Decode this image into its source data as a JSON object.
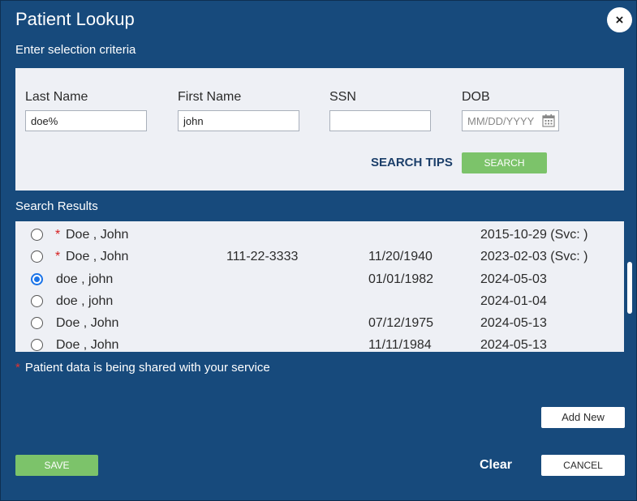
{
  "dialog": {
    "title": "Patient Lookup",
    "subtitle": "Enter selection criteria",
    "close_icon": "×"
  },
  "criteria": {
    "last_name_label": "Last Name",
    "last_name_value": "doe%",
    "first_name_label": "First Name",
    "first_name_value": "john",
    "ssn_label": "SSN",
    "ssn_value": "",
    "dob_label": "DOB",
    "dob_value": "",
    "dob_placeholder": "MM/DD/YYYY",
    "calendar_icon": "calendar-icon",
    "search_tips_label": "SEARCH TIPS",
    "search_label": "SEARCH"
  },
  "results": {
    "label": "Search Results",
    "rows": [
      {
        "shared": "*",
        "name": "Doe , John",
        "ssn": "",
        "dob": "",
        "date": "2015-10-29 (Svc: )",
        "selected": false
      },
      {
        "shared": "*",
        "name": "Doe , John",
        "ssn": "111-22-3333",
        "dob": "11/20/1940",
        "date": "2023-02-03 (Svc: )",
        "selected": false
      },
      {
        "shared": "",
        "name": "doe , john",
        "ssn": "",
        "dob": "01/01/1982",
        "date": "2024-05-03",
        "selected": true
      },
      {
        "shared": "",
        "name": "doe , john",
        "ssn": "",
        "dob": "",
        "date": "2024-01-04",
        "selected": false
      },
      {
        "shared": "",
        "name": "Doe , John",
        "ssn": "",
        "dob": "07/12/1975",
        "date": "2024-05-13",
        "selected": false
      },
      {
        "shared": "",
        "name": "Doe , John",
        "ssn": "",
        "dob": "11/11/1984",
        "date": "2024-05-13",
        "selected": false
      }
    ]
  },
  "footnote": {
    "star": "*",
    "text": "Patient data is being shared with your service"
  },
  "actions": {
    "add_new_label": "Add New",
    "save_label": "SAVE",
    "clear_label": "Clear",
    "cancel_label": "CANCEL"
  },
  "colors": {
    "dialog_bg": "#174a7c",
    "panel_bg": "#eef0f5",
    "accent_green": "#7cc36a",
    "shared_star": "#d62020",
    "radio_selected": "#1a73e8"
  }
}
